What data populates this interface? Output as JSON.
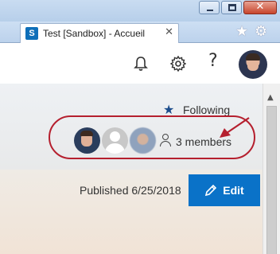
{
  "browser": {
    "tab_title": "Test [Sandbox] - Accueil",
    "tab_icon_letter": "S",
    "close_glyph": "✕",
    "tab_close_glyph": "✕",
    "favorites_glyph": "★",
    "tools_glyph": "⚙"
  },
  "suite_bar": {
    "help_glyph": "?"
  },
  "page_header": {
    "follow_label": "Following",
    "follow_glyph": "★",
    "members_label": "3 members",
    "published_label": "Published 6/25/2018",
    "edit_label": "Edit"
  },
  "colors": {
    "accent": "#0a72c8",
    "callout": "#b51f2e",
    "follow_star": "#1c4d8c"
  }
}
